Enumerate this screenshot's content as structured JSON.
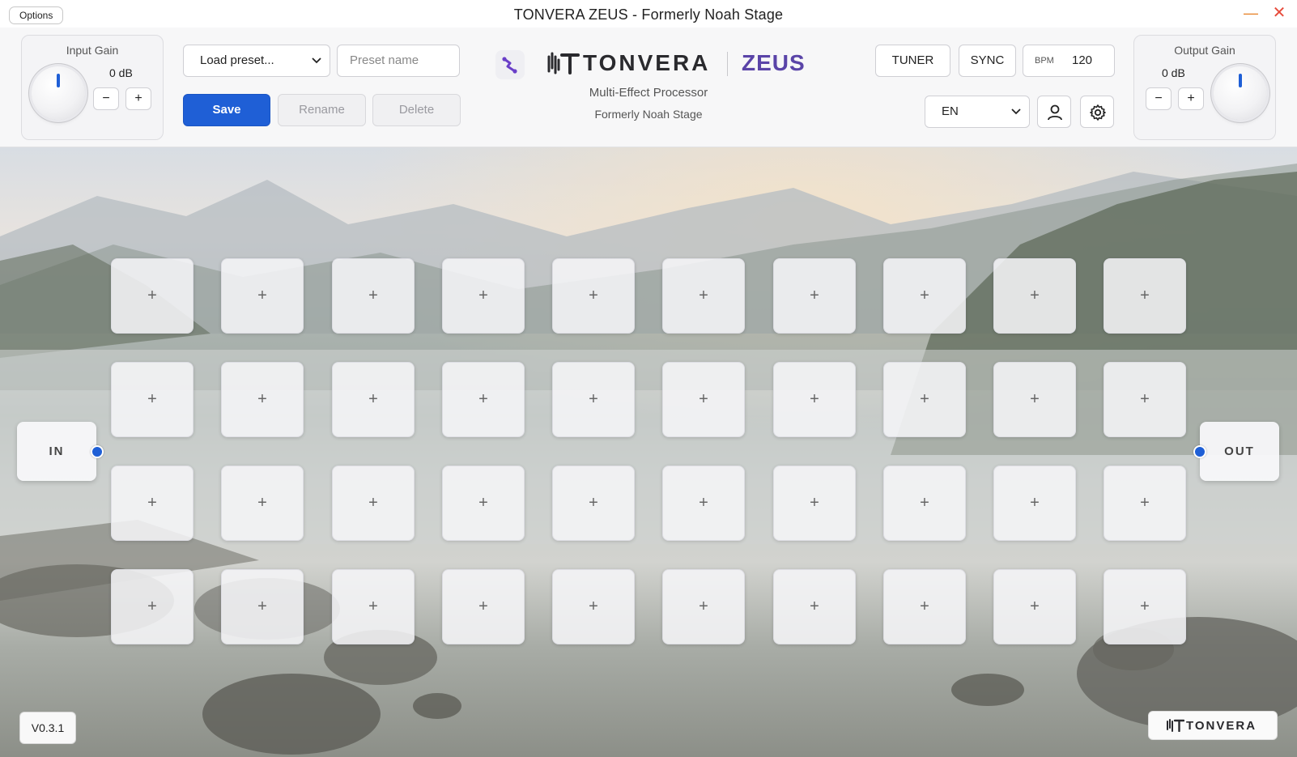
{
  "window": {
    "title": "TONVERA ZEUS - Formerly Noah Stage",
    "options_label": "Options"
  },
  "input_gain": {
    "title": "Input Gain",
    "value": "0 dB",
    "minus": "−",
    "plus": "+"
  },
  "output_gain": {
    "title": "Output Gain",
    "value": "0 dB",
    "minus": "−",
    "plus": "+"
  },
  "preset": {
    "select_value": "Load preset...",
    "name_placeholder": "Preset name",
    "save_label": "Save",
    "rename_label": "Rename",
    "delete_label": "Delete"
  },
  "brand": {
    "name": "TONVERA",
    "product": "ZEUS",
    "subtitle": "Multi-Effect Processor",
    "subtitle2": "Formerly Noah Stage",
    "accent": "#5a44a8",
    "primary": "#1f5fd6"
  },
  "controls": {
    "tuner_label": "TUNER",
    "sync_label": "SYNC",
    "bpm_label": "BPM",
    "bpm_value": "120",
    "language": "EN"
  },
  "chain": {
    "in_label": "IN",
    "out_label": "OUT",
    "slot_symbol": "+"
  },
  "footer": {
    "version": "V0.3.1",
    "logo_text": "TONVERA"
  }
}
